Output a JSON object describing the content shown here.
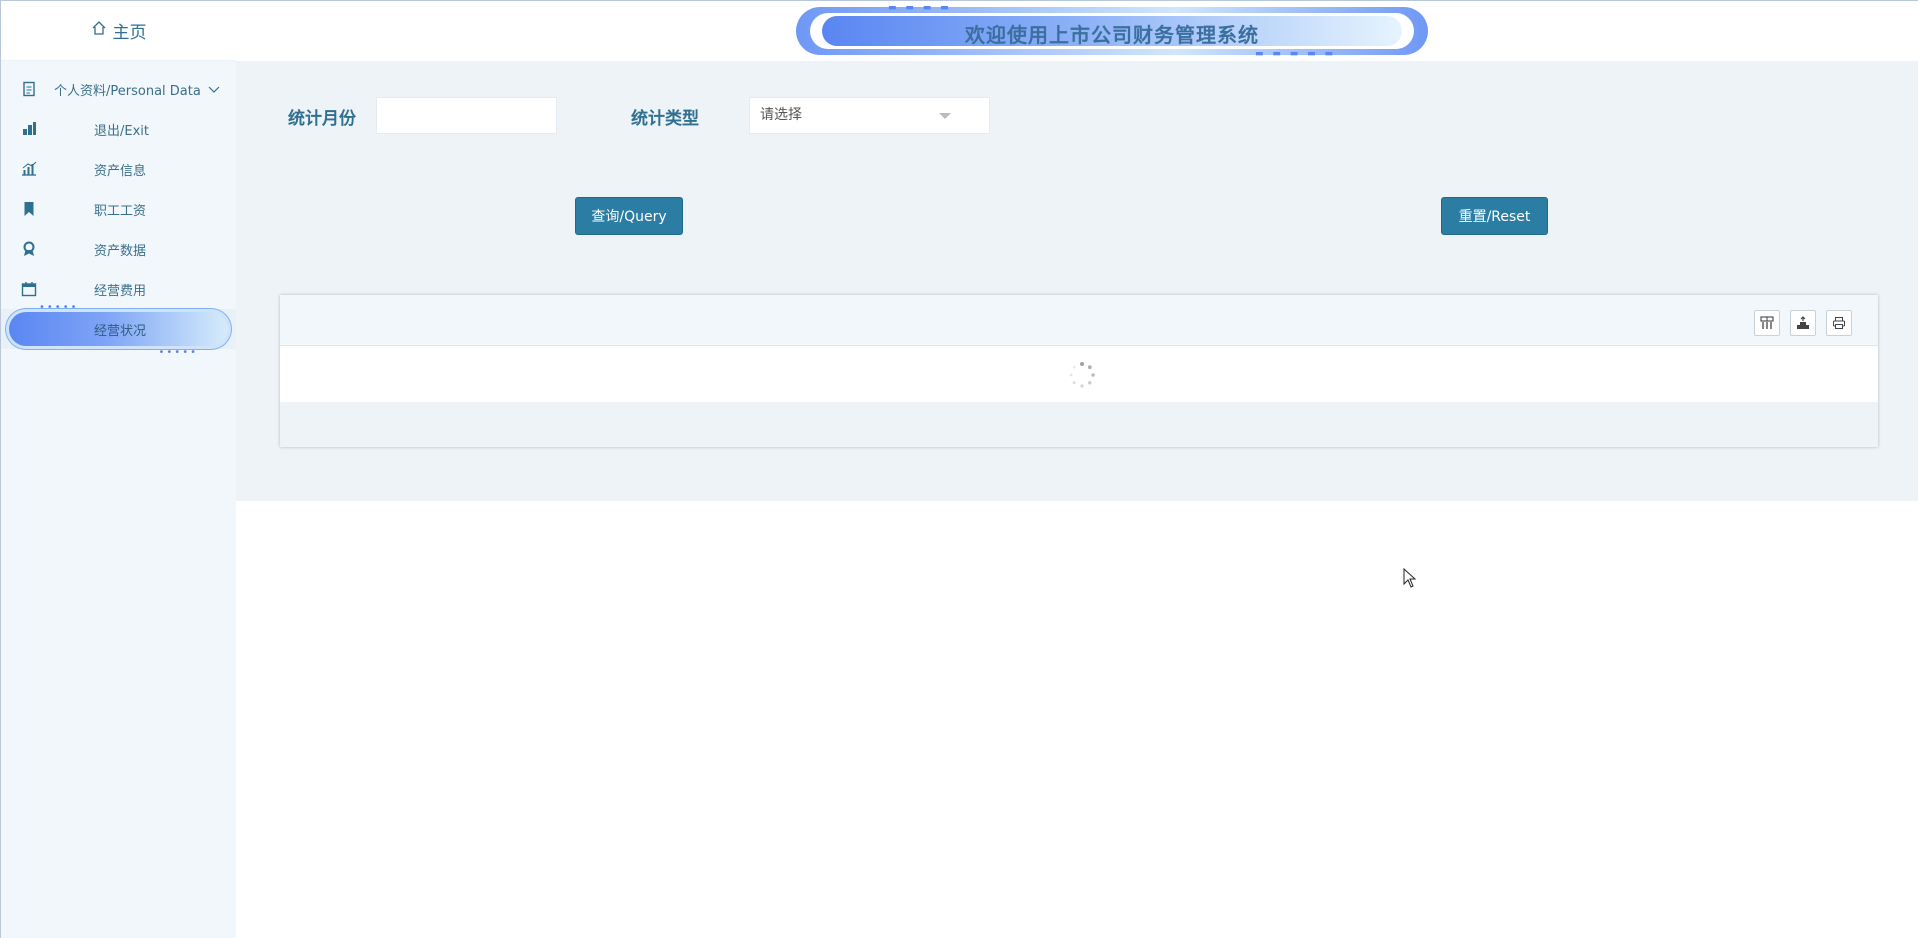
{
  "sidebar": {
    "home_label": "主页",
    "items": [
      {
        "label": "个人资料/Personal Data",
        "icon": "document-icon"
      },
      {
        "label": "退出/Exit",
        "icon": "exit-icon"
      },
      {
        "label": "资产信息",
        "icon": "chart-icon"
      },
      {
        "label": "职工工资",
        "icon": "bookmark-icon"
      },
      {
        "label": "资产数据",
        "icon": "award-icon"
      },
      {
        "label": "经营费用",
        "icon": "calendar-icon"
      },
      {
        "label": "经营状况",
        "icon": "none"
      }
    ]
  },
  "header": {
    "title": "欢迎使用上市公司财务管理系统"
  },
  "filters": {
    "month_label": "统计月份",
    "month_value": "",
    "type_label": "统计类型",
    "type_placeholder": "请选择"
  },
  "buttons": {
    "query": "查询/Query",
    "reset": "重置/Reset"
  },
  "colors": {
    "accent": "#2b7da3",
    "sidebar_bg": "#f2f7fb",
    "main_bg": "#eef3f7"
  }
}
